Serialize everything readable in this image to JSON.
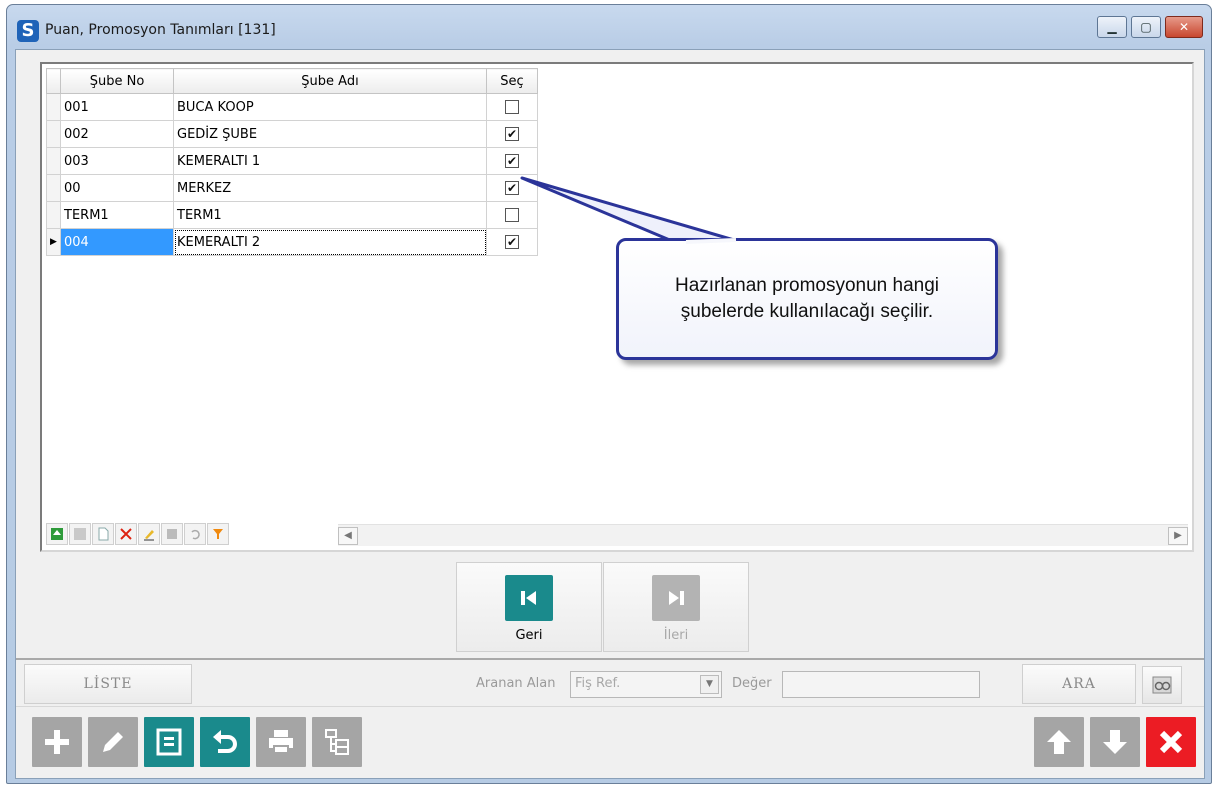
{
  "window": {
    "title": "Puan, Promosyon Tanımları  [131]",
    "icon": "app-s-icon"
  },
  "grid": {
    "columns": [
      "Şube No",
      "Şube Adı",
      "Seç"
    ],
    "rows": [
      {
        "no": "001",
        "ad": "BUCA KOOP",
        "sec": false
      },
      {
        "no": "002",
        "ad": "GEDİZ ŞUBE",
        "sec": true
      },
      {
        "no": "003",
        "ad": "KEMERALTI 1",
        "sec": true
      },
      {
        "no": "00",
        "ad": "MERKEZ",
        "sec": true
      },
      {
        "no": "TERM1",
        "ad": "TERM1",
        "sec": false
      },
      {
        "no": "004",
        "ad": "KEMERALTI 2",
        "sec": true
      }
    ],
    "selected_row_index": 5,
    "check_mark": "✔",
    "row_indicator": "▶"
  },
  "callout": {
    "line1": "Hazırlanan promosyonun hangi",
    "line2": "şubelerde kullanılacağı seçilir."
  },
  "nav": {
    "back_label": "Geri",
    "next_label": "İleri"
  },
  "search": {
    "liste_label": "LİSTE",
    "field_label": "Aranan Alan",
    "field_value": "Fiş Ref.",
    "value_label": "Değer",
    "value": "",
    "search_button": "ARA"
  },
  "colors": {
    "accent_teal": "#1a8a8c",
    "selection_blue": "#3399ff",
    "close_red": "#ec1c24",
    "callout_border": "#2b3499"
  }
}
